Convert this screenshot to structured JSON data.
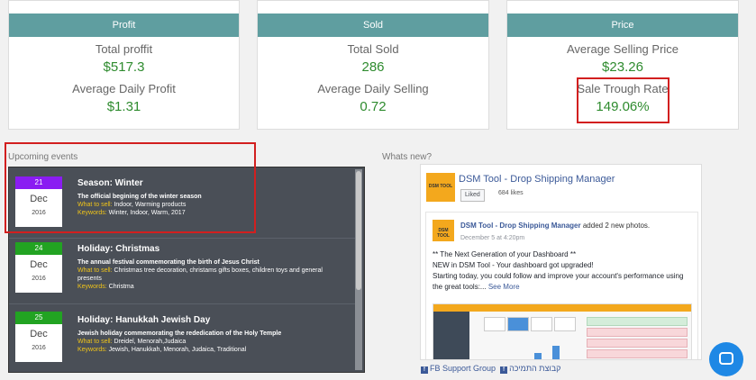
{
  "cards": [
    {
      "header": "Profit",
      "label1": "Total proffit",
      "value1": "$517.3",
      "label2": "Average Daily Profit",
      "value2": "$1.31"
    },
    {
      "header": "Sold",
      "label1": "Total Sold",
      "value1": "286",
      "label2": "Average Daily Selling",
      "value2": "0.72"
    },
    {
      "header": "Price",
      "label1": "Average Selling Price",
      "value1": "$23.26",
      "label2": "Sale Trough Rate",
      "value2": "149.06%"
    }
  ],
  "events_label": "Upcoming events",
  "whats_new_label": "Whats new?",
  "events": [
    {
      "day": "21",
      "day_color": "#8a1cf2",
      "month": "Dec",
      "year": "2016",
      "title": "Season: Winter",
      "description": "The official begining of the winter season",
      "what_label": "What to sell:",
      "what": "Indoor, Warming products",
      "kw_label": "Keywords:",
      "keywords": "Winter, Indoor, Warm, 2017"
    },
    {
      "day": "24",
      "day_color": "#22a322",
      "month": "Dec",
      "year": "2016",
      "title": "Holiday: Christmas",
      "description": "The annual festival commemorating the birth of Jesus Christ",
      "what_label": "What to sell:",
      "what": "Christmas tree decoration, christams gifts boxes, children toys and general presents",
      "kw_label": "Keywords:",
      "keywords": "Christma"
    },
    {
      "day": "25",
      "day_color": "#22a322",
      "month": "Dec",
      "year": "2016",
      "title": "Holiday: Hanukkah Jewish Day",
      "description": "Jewish holiday commemorating the rededication of the Holy Temple",
      "what_label": "What to sell:",
      "what": "Dreidel, Menorah,Judaica",
      "kw_label": "Keywords:",
      "keywords": "Jewish, Hanukkah, Menorah, Judaica, Traditional"
    }
  ],
  "fb": {
    "logo_text": "DSM TOOL",
    "page_name": "DSM Tool - Drop Shipping Manager",
    "liked_label": "Liked",
    "likes": "684 likes",
    "post_author": "DSM Tool - Drop Shipping Manager",
    "post_action": " added 2 new photos.",
    "post_date": "December 5 at 4:20pm",
    "post_line1": "** The Next Generation of your Dashboard **",
    "post_line2": "NEW in DSM Tool - Your dashboard got upgraded!",
    "post_line3": "Starting today, you could follow and improve your account's performance using the great tools:...",
    "see_more": "See More"
  },
  "fb_links": {
    "support": "FB Support Group",
    "hebrew": "קבוצת התמיכה"
  },
  "icons": {
    "chat": "chat-icon",
    "facebook": "facebook-icon"
  }
}
